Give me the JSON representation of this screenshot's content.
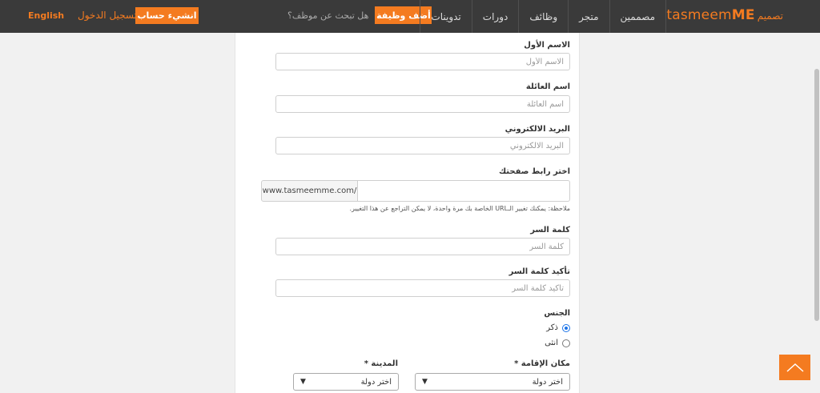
{
  "header": {
    "language_link": "English",
    "login_link": "تسجيل الدخول",
    "create_account_button": "انشيء حساب",
    "hire_question": "هل تبحث عن موظف؟",
    "add_job_button": "أضف وظيفة",
    "nav": [
      "مصممين",
      "متجر",
      "وظائف",
      "دورات",
      "تدوينات"
    ],
    "logo_text_prefix": "tasmeem",
    "logo_text_suffix": "ME",
    "logo_arabic": "تصميم"
  },
  "form": {
    "first_name": {
      "label": "الاسم الأول",
      "placeholder": "الاسم الأول"
    },
    "last_name": {
      "label": "اسم العائلة",
      "placeholder": "اسم العائلة"
    },
    "email": {
      "label": "البريد الالكتروني",
      "placeholder": "البريد الالكتروني"
    },
    "page_link": {
      "label": "اختر رابط صفحتك",
      "prefix": "www.tasmeemme.com/",
      "value": ""
    },
    "note": "ملاحظة: يمكنك تغيير الـURL الخاصة بك مرة واحدة، لا يمكن التراجع عن هذا التغيير.",
    "password": {
      "label": "كلمة السر",
      "placeholder": "كلمة السر"
    },
    "confirm_password": {
      "label": "تأكيد كلمة السر",
      "placeholder": "تأكيد كلمة السر"
    },
    "gender": {
      "label": "الجنس",
      "options": [
        "ذكر",
        "انثى"
      ],
      "selected": "ذكر"
    },
    "residence": {
      "label": "مكان الإقامة *",
      "value": "اختر دولة"
    },
    "city": {
      "label": "المدينة *",
      "value": "اختر دولة"
    }
  },
  "colors": {
    "accent": "#f47b20",
    "topbar": "#3a3a3a",
    "radio_selected": "#1a73e8"
  },
  "icons": {
    "scroll_top": "chevron-up-icon",
    "select_arrow": "chevron-down-icon"
  }
}
